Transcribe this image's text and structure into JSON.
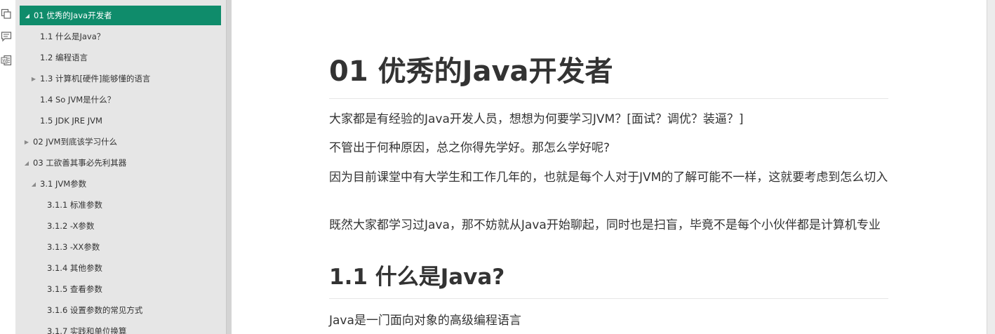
{
  "colors": {
    "accent": "#0f8c6b",
    "sidebar_bg": "#e6e6e6",
    "text": "#333333"
  },
  "rail_icons": [
    "outline-pages-icon",
    "comment-icon",
    "word-export-icon"
  ],
  "toc": [
    {
      "label": "01 优秀的Java开发者",
      "marker": "◢",
      "active": true
    },
    {
      "label": "1.1 什么是Java？",
      "marker": ""
    },
    {
      "label": "1.2 编程语言",
      "marker": ""
    },
    {
      "label": "1.3 计算机[硬件]能够懂的语言",
      "marker": "▶"
    },
    {
      "label": "1.4 So JVM是什么？",
      "marker": ""
    },
    {
      "label": "1.5 JDK JRE JVM",
      "marker": ""
    },
    {
      "label": "02 JVM到底该学习什么",
      "marker": "▶"
    },
    {
      "label": "03 工欲善其事必先利其器",
      "marker": "◢"
    },
    {
      "label": "3.1 JVM参数",
      "marker": "◢"
    },
    {
      "label": "3.1.1 标准参数",
      "marker": ""
    },
    {
      "label": "3.1.2 -X参数",
      "marker": ""
    },
    {
      "label": "3.1.3 -XX参数",
      "marker": ""
    },
    {
      "label": "3.1.4 其他参数",
      "marker": ""
    },
    {
      "label": "3.1.5 查看参数",
      "marker": ""
    },
    {
      "label": "3.1.6 设置参数的常见方式",
      "marker": ""
    },
    {
      "label": "3.1.7 实践和单位换算",
      "marker": ""
    }
  ],
  "doc": {
    "h1": "01 优秀的Java开发者",
    "p1": "大家都是有经验的Java开发人员，想想为何要学习JVM？[面试？调优？装逼？]",
    "p2": "不管出于何种原因，总之你得先学好。那怎么学好呢?",
    "p3": "因为目前课堂中有大学生和工作几年的，也就是每个人对于JVM的了解可能不一样，这就要考虑到怎么切入",
    "p4": "既然大家都学习过Java，那不妨就从Java开始聊起，同时也是扫盲，毕竟不是每个小伙伴都是计算机专业",
    "h2": "1.1 什么是Java?",
    "p5": "Java是一门面向对象的高级编程语言"
  }
}
